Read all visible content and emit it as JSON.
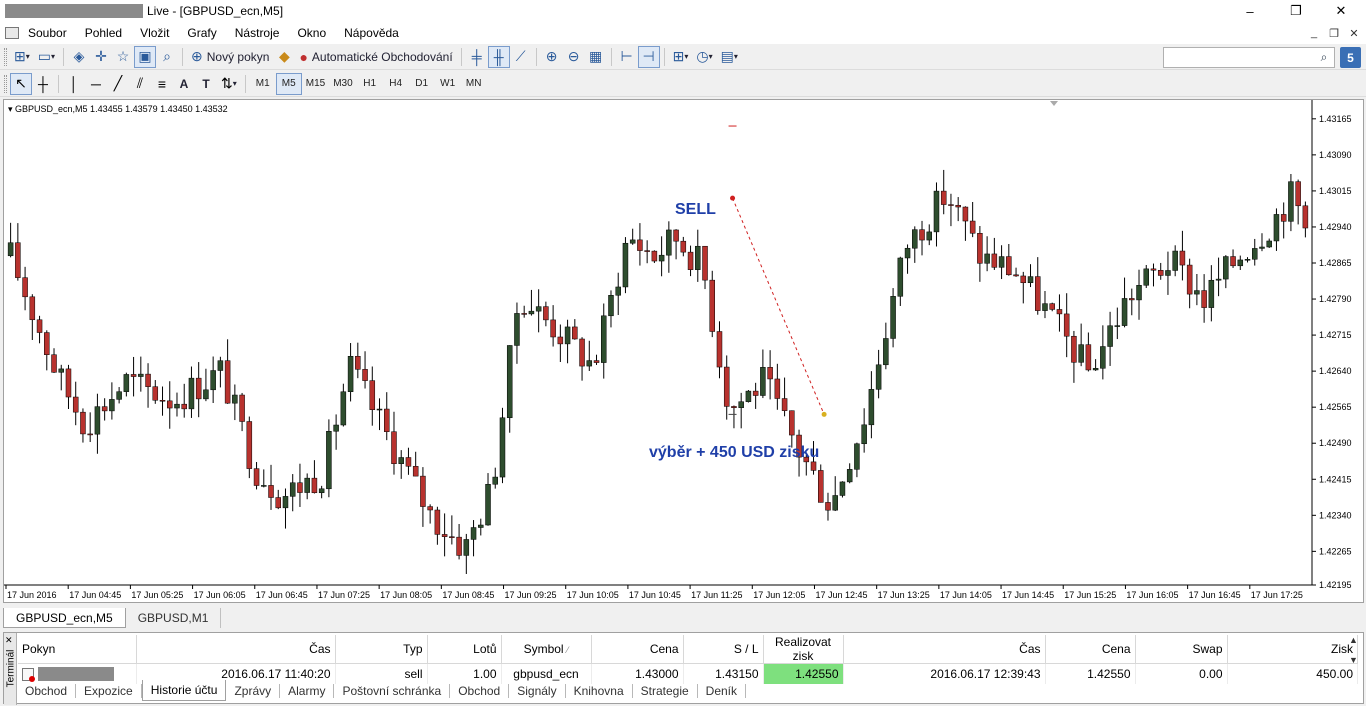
{
  "window": {
    "title": "Live - [GBPUSD_ecn,M5]",
    "title_visible": "Live - [GBPUSD_ecn,M5]",
    "minimize": "–",
    "maximize": "❐",
    "close": "✕"
  },
  "menu": [
    "Soubor",
    "Pohled",
    "Vložit",
    "Grafy",
    "Nástroje",
    "Okno",
    "Nápověda"
  ],
  "toolbar": {
    "new_order": "Nový pokyn",
    "auto_trading": "Automatické Obchodování"
  },
  "timeframes": [
    "M1",
    "M5",
    "M15",
    "M30",
    "H1",
    "H4",
    "D1",
    "W1",
    "MN"
  ],
  "active_timeframe": "M5",
  "chart": {
    "header": "GBPUSD_ecn,M5  1.43455 1.43579 1.43450 1.43532",
    "annotation_sell": "SELL",
    "annotation_result": "výběr + 450 USD zisku",
    "annotation_color": "#1f3fa8",
    "bull_color": "#2e4d2e",
    "bear_color": "#b8322e"
  },
  "chart_data": {
    "type": "candlestick",
    "symbol": "GBPUSD_ecn",
    "timeframe": "M5",
    "y_ticks": [
      1.43165,
      1.4309,
      1.43015,
      1.4294,
      1.42865,
      1.4279,
      1.42715,
      1.4264,
      1.42565,
      1.4249,
      1.42415,
      1.4234,
      1.42265,
      1.42195
    ],
    "x_ticks": [
      "17 Jun 2016",
      "17 Jun 04:45",
      "17 Jun 05:25",
      "17 Jun 06:05",
      "17 Jun 06:45",
      "17 Jun 07:25",
      "17 Jun 08:05",
      "17 Jun 08:45",
      "17 Jun 09:25",
      "17 Jun 10:05",
      "17 Jun 10:45",
      "17 Jun 11:25",
      "17 Jun 12:05",
      "17 Jun 12:45",
      "17 Jun 13:25",
      "17 Jun 14:05",
      "17 Jun 14:45",
      "17 Jun 15:25",
      "17 Jun 16:05",
      "17 Jun 16:45",
      "17 Jun 17:25"
    ],
    "ylim": [
      1.42195,
      1.432
    ],
    "trade": {
      "type": "sell",
      "open_price": 1.43,
      "close_price": 1.4255,
      "sl": 1.4315,
      "tp": 1.4255
    }
  },
  "chart_tabs": [
    "GBPUSD_ecn,M5",
    "GBPUSD,M1"
  ],
  "terminal": {
    "side_label": "Terminál",
    "columns": [
      "Pokyn",
      "Čas",
      "Typ",
      "Lotů",
      "Symbol",
      "Cena",
      "S / L",
      "Realizovat zisk",
      "Čas",
      "Cena",
      "Swap",
      "Zisk"
    ],
    "row": {
      "open_time": "2016.06.17 11:40:20",
      "type": "sell",
      "lots": "1.00",
      "symbol": "gbpusd_ecn",
      "price": "1.43000",
      "sl": "1.43150",
      "tp": "1.42550",
      "close_time": "2016.06.17 12:39:43",
      "close_price": "1.42550",
      "swap": "0.00",
      "profit": "450.00"
    },
    "tabs": [
      "Obchod",
      "Expozice",
      "Historie účtu",
      "Zprávy",
      "Alarmy",
      "Poštovní schránka",
      "Obchod",
      "Signály",
      "Knihovna",
      "Strategie",
      "Deník"
    ],
    "active_tab": "Historie účtu"
  }
}
